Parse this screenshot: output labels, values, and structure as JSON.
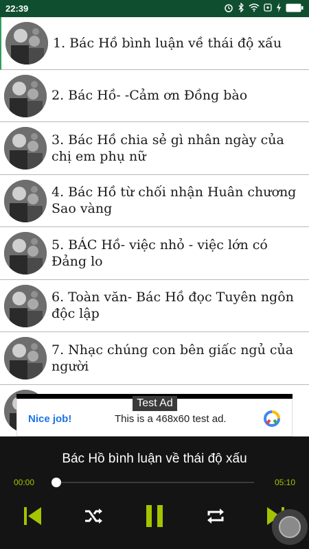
{
  "status_bar": {
    "time": "22:39",
    "icons": [
      "alarm-icon",
      "bluetooth-icon",
      "wifi-icon",
      "battery-saver-icon",
      "charging-icon",
      "battery-icon"
    ]
  },
  "tracks": [
    {
      "label": "1. Bác Hồ bình luận về thái độ xấu",
      "active": true
    },
    {
      "label": "2. Bác Hồ- -Cảm ơn Đồng bào"
    },
    {
      "label": "3. Bác Hồ chia sẻ gì nhân ngày của chị em phụ nữ"
    },
    {
      "label": "4. Bác Hồ từ chối nhận Huân chương Sao vàng"
    },
    {
      "label": "5. BÁC Hồ- việc nhỏ - việc lớn có Đảng lo"
    },
    {
      "label": "6. Toàn văn- Bác Hồ đọc Tuyên ngôn độc lập"
    },
    {
      "label": "7. Nhạc chúng con bên giấc ngủ của người"
    }
  ],
  "ad": {
    "tag": "Test Ad",
    "left_text": "Nice job!",
    "center_text": "This is a 468x60 test ad."
  },
  "player": {
    "title": "Bác Hồ bình luận về thái độ xấu",
    "elapsed": "00:00",
    "total": "05:10",
    "progress": 0.0,
    "controls": [
      "skip-previous-icon",
      "shuffle-icon",
      "pause-icon",
      "repeat-icon",
      "skip-next-icon"
    ]
  },
  "colors": {
    "status_bar": "#0f4f2f",
    "accent": "#a4c400",
    "player_bg": "#141414",
    "ad_link": "#1a73e8"
  }
}
